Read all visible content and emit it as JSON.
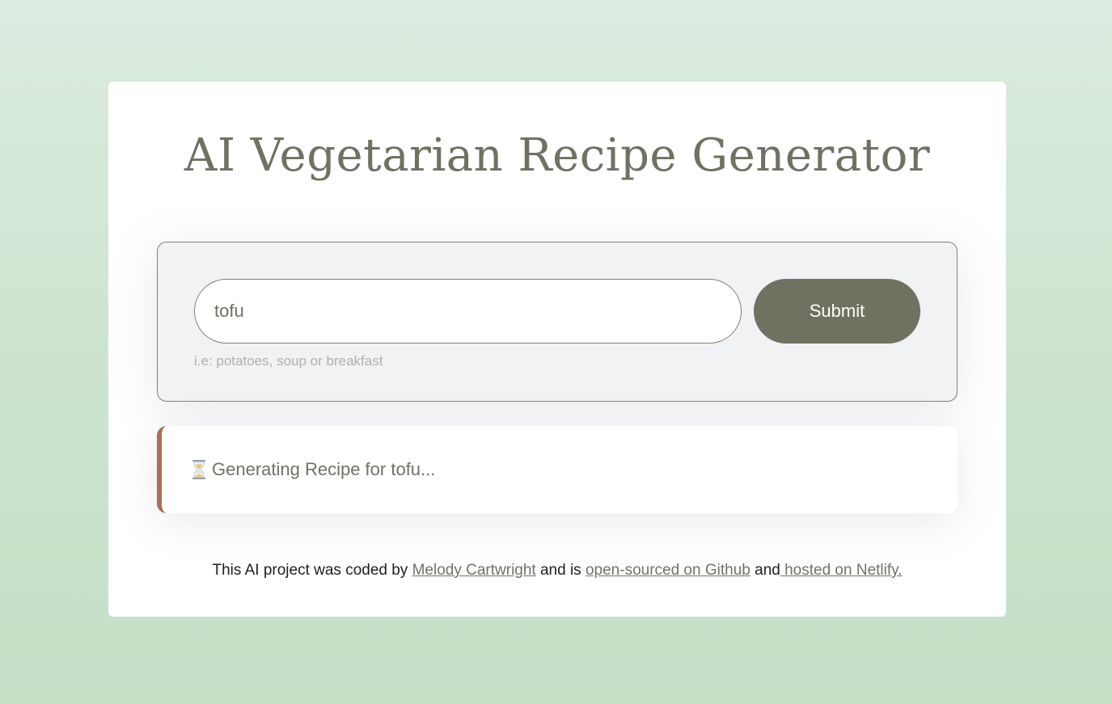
{
  "page": {
    "title": "AI Vegetarian Recipe Generator"
  },
  "form": {
    "input_value": "tofu",
    "submit_label": "Submit",
    "hint": "i.e: potatoes, soup or breakfast"
  },
  "status": {
    "icon": "hourglass-icon",
    "text": "Generating Recipe for tofu..."
  },
  "footer": {
    "prefix": "This AI project was coded by ",
    "author_link": "Melody Cartwright",
    "middle": " and is ",
    "github_link": "open-sourced on Github",
    "and_text": " and",
    "netlify_link": " hosted on Netlify."
  },
  "colors": {
    "accent": "#717161",
    "title": "#6f7262",
    "status_border": "#a8705a",
    "background_top": "#dcebdf",
    "background_bottom": "#c4e0c7"
  }
}
